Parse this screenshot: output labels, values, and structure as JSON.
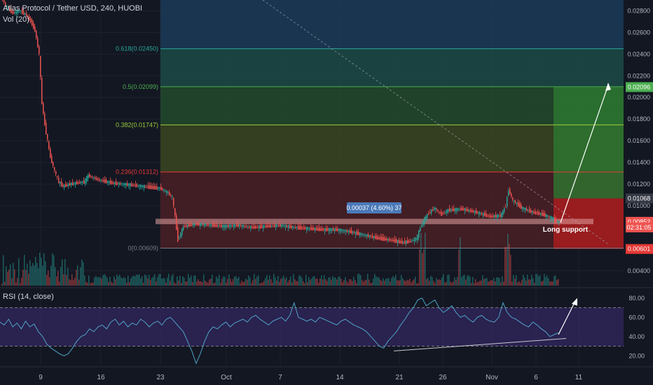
{
  "header": {
    "symbol": "Atlas Protocol / Tether USD, 240, HUOBI",
    "volume": "Vol (20)"
  },
  "rsi_header": "RSI (14, close)",
  "colors": {
    "background": "#131722",
    "up": "#26a69a",
    "down": "#ef5350",
    "rsi": "#4fa3c7",
    "rsi_band": "#3b2a6e",
    "long_profit": "#2e7d32",
    "long_loss": "#b71c1c"
  },
  "chart_data": [
    {
      "type": "candlestick",
      "title": "Atlas Protocol / Tether USD, 240, HUOBI",
      "x_tick_labels": [
        "9",
        "16",
        "23",
        "Oct",
        "7",
        "14",
        "21",
        "26",
        "Nov",
        "6",
        "11"
      ],
      "y_tick_labels": [
        "0.02800",
        "0.02600",
        "0.02400",
        "0.02200",
        "0.02000",
        "0.01800",
        "0.01600",
        "0.01400",
        "0.01200",
        "0.01000",
        "0.00800",
        "0.00400"
      ],
      "ylim": [
        0.0025,
        0.029
      ],
      "price_path": [
        [
          0,
          0.0295
        ],
        [
          8,
          0.0285
        ],
        [
          18,
          0.0278
        ],
        [
          28,
          0.028
        ],
        [
          38,
          0.0276
        ],
        [
          44,
          0.027
        ],
        [
          50,
          0.0262
        ],
        [
          56,
          0.024
        ],
        [
          60,
          0.0195
        ],
        [
          64,
          0.0175
        ],
        [
          68,
          0.016
        ],
        [
          72,
          0.0145
        ],
        [
          78,
          0.0132
        ],
        [
          84,
          0.0122
        ],
        [
          90,
          0.0118
        ],
        [
          100,
          0.012
        ],
        [
          110,
          0.0121
        ],
        [
          120,
          0.0122
        ],
        [
          126,
          0.0128
        ],
        [
          140,
          0.0124
        ],
        [
          160,
          0.0121
        ],
        [
          190,
          0.0119
        ],
        [
          215,
          0.0117
        ],
        [
          230,
          0.0116
        ],
        [
          240,
          0.0112
        ],
        [
          246,
          0.0108
        ],
        [
          250,
          0.009
        ],
        [
          254,
          0.0068
        ],
        [
          262,
          0.0081
        ],
        [
          280,
          0.0083
        ],
        [
          300,
          0.0082
        ],
        [
          320,
          0.0081
        ],
        [
          340,
          0.0082
        ],
        [
          360,
          0.008
        ],
        [
          380,
          0.0081
        ],
        [
          400,
          0.0082
        ],
        [
          420,
          0.008
        ],
        [
          440,
          0.0079
        ],
        [
          460,
          0.0078
        ],
        [
          480,
          0.0078
        ],
        [
          500,
          0.0076
        ],
        [
          520,
          0.0073
        ],
        [
          540,
          0.007
        ],
        [
          560,
          0.0068
        ],
        [
          575,
          0.0066
        ],
        [
          585,
          0.0067
        ],
        [
          595,
          0.007
        ],
        [
          600,
          0.008
        ],
        [
          606,
          0.0088
        ],
        [
          612,
          0.0093
        ],
        [
          620,
          0.0098
        ],
        [
          630,
          0.0092
        ],
        [
          640,
          0.0096
        ],
        [
          660,
          0.0097
        ],
        [
          680,
          0.0094
        ],
        [
          700,
          0.009
        ],
        [
          715,
          0.0091
        ],
        [
          722,
          0.01
        ],
        [
          726,
          0.0115
        ],
        [
          732,
          0.0105
        ],
        [
          745,
          0.0098
        ],
        [
          760,
          0.0094
        ],
        [
          775,
          0.0092
        ],
        [
          790,
          0.0088
        ],
        [
          797,
          0.0085
        ]
      ],
      "fibonacci": [
        {
          "label": "0.618(0.02450)",
          "value": 0.0245,
          "color": "#26a69a"
        },
        {
          "label": "0.5(0.02099)",
          "value": 0.02099,
          "color": "#4caf50"
        },
        {
          "label": "0.382(0.01747)",
          "value": 0.01747,
          "color": "#9ccc3d"
        },
        {
          "label": "0.236(0.01312)",
          "value": 0.01312,
          "color": "#e53935"
        },
        {
          "label": "0(0.00609)",
          "value": 0.00609,
          "color": "#787b86"
        }
      ],
      "price_labels": [
        {
          "text": "0.02096",
          "value": 0.02096,
          "color": "#4caf50"
        },
        {
          "text": "0.01068",
          "value": 0.01068,
          "color": "#363a45"
        },
        {
          "text": "0.00852",
          "value": 0.00852,
          "color": "#ef5350"
        },
        {
          "text": "02:31:05",
          "value": 0.008,
          "color": "#ef5350"
        },
        {
          "text": "0.00601",
          "value": 0.00601,
          "color": "#e53935"
        }
      ],
      "measure_label": "0.00037 (4.60%) 37",
      "annotation": "Long support",
      "support_zone": [
        0.0083,
        0.0088
      ],
      "long_position": {
        "entry": 0.01068,
        "target": 0.02096,
        "stop": 0.00601
      }
    },
    {
      "type": "line",
      "title": "RSI (14, close)",
      "y_tick_labels": [
        "80.00",
        "60.00",
        "40.00",
        "20.00"
      ],
      "ylim": [
        10,
        90
      ],
      "bands": [
        30,
        70
      ],
      "series": [
        {
          "values": [
            55,
            52,
            58,
            50,
            54,
            48,
            56,
            50,
            53,
            45,
            40,
            32,
            28,
            25,
            22,
            20,
            22,
            28,
            35,
            40,
            42,
            48,
            45,
            50,
            52,
            48,
            55,
            58,
            52,
            56,
            50,
            54,
            52,
            58,
            55,
            50,
            54,
            56,
            52,
            58,
            60,
            55,
            50,
            45,
            35,
            25,
            12,
            22,
            35,
            45,
            50,
            48,
            52,
            55,
            50,
            54,
            56,
            58,
            55,
            60,
            62,
            58,
            55,
            52,
            56,
            58,
            60,
            56,
            62,
            75,
            60,
            58,
            56,
            58,
            55,
            60,
            58,
            56,
            54,
            52,
            56,
            58,
            55,
            52,
            50,
            48,
            45,
            40,
            35,
            30,
            28,
            35,
            40,
            45,
            52,
            58,
            65,
            70,
            78,
            80,
            72,
            75,
            78,
            70,
            65,
            68,
            72,
            65,
            60,
            62,
            58,
            55,
            60,
            62,
            58,
            56,
            55,
            60,
            75,
            65,
            60,
            58,
            55,
            52,
            50,
            55,
            52,
            48,
            45,
            40,
            42,
            44
          ]
        }
      ]
    }
  ]
}
